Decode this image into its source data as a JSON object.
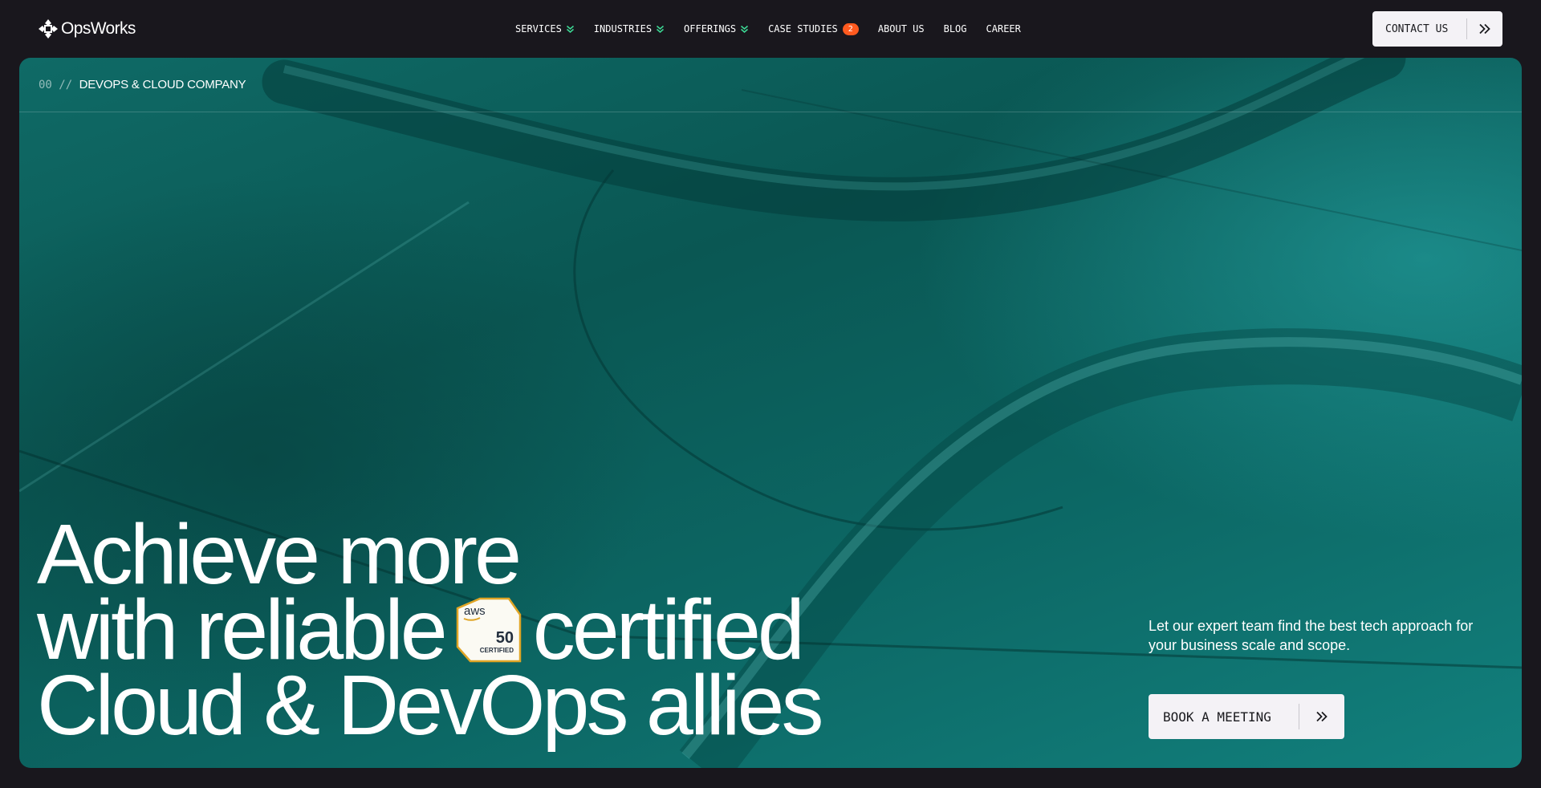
{
  "header": {
    "logo_text": "OpsWorks",
    "logo_icon": "opsworks-logo-icon",
    "nav": [
      {
        "label": "SERVICES",
        "has_dropdown": true
      },
      {
        "label": "INDUSTRIES",
        "has_dropdown": true
      },
      {
        "label": "OFFERINGS",
        "has_dropdown": true
      },
      {
        "label": "CASE STUDIES",
        "badge": "2"
      },
      {
        "label": "ABOUT US"
      },
      {
        "label": "BLOG"
      },
      {
        "label": "CAREER"
      }
    ],
    "contact_label": "CONTACT US",
    "contact_icon": "double-chevron-right-icon"
  },
  "hero": {
    "eyebrow_number": "00",
    "eyebrow_separator": "//",
    "eyebrow_label": "DEVOPS & CLOUD COMPANY",
    "headline_line1": "Achieve more",
    "headline_line2_before": "with reliable",
    "headline_line2_after": "certified",
    "headline_line3": "Cloud & DevOps allies",
    "aws_badge": {
      "brand": "aws",
      "count": "50",
      "caption": "CERTIFIED",
      "icon": "aws-certified-badge-icon"
    },
    "lead_text": "Let our expert team find the best tech approach for your business scale and scope.",
    "cta_label": "BOOK A MEETING",
    "cta_icon": "double-chevron-right-icon"
  },
  "colors": {
    "page_background": "#19171d",
    "hero_teal": "#0c6764",
    "accent_green": "#3ddc97",
    "badge_orange": "#ff5a1f",
    "button_background": "#f4f2f6",
    "aws_badge_gold": "#e0a526"
  }
}
